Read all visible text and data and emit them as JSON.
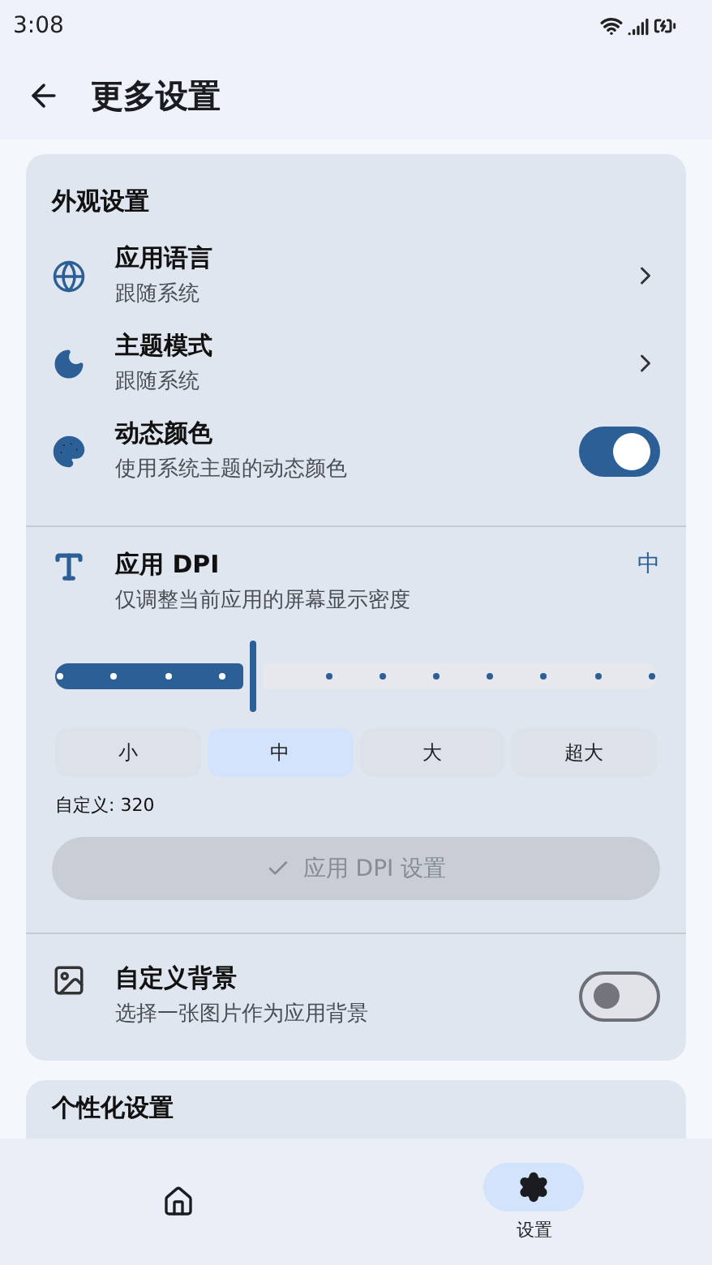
{
  "status_bar": {
    "time": "3:08"
  },
  "app_bar": {
    "title": "更多设置"
  },
  "appearance": {
    "title": "外观设置",
    "items": [
      {
        "kind": "link",
        "title": "应用语言",
        "subtitle": "跟随系统"
      },
      {
        "kind": "link",
        "title": "主题模式",
        "subtitle": "跟随系统"
      },
      {
        "kind": "switch",
        "title": "动态颜色",
        "subtitle": "使用系统主题的动态颜色",
        "on": true
      }
    ],
    "dpi": {
      "title": "应用 DPI",
      "subtitle": "仅调整当前应用的屏幕显示密度",
      "current": "中",
      "level": 0.33,
      "presets": [
        {
          "label": "小",
          "selected": false
        },
        {
          "label": "中",
          "selected": true
        },
        {
          "label": "大",
          "selected": false
        },
        {
          "label": "超大",
          "selected": false
        }
      ],
      "custom": "自定义: 320",
      "apply_button": {
        "label": "应用 DPI 设置",
        "disabled": true
      }
    },
    "background": {
      "title": "自定义背景",
      "subtitle": "选择一张图片作为应用背景",
      "on": false
    }
  },
  "personalization": {
    "title": "个性化设置"
  },
  "nav": [
    {
      "selected": false
    },
    {
      "label": "设置",
      "selected": true
    }
  ]
}
